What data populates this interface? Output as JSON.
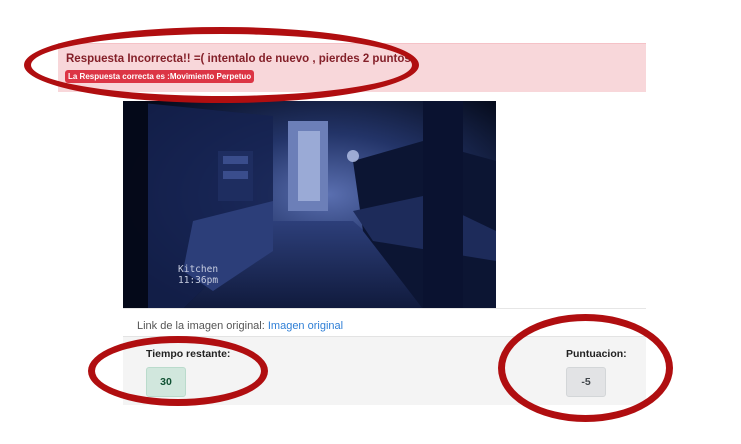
{
  "alert": {
    "message": "Respuesta Incorrecta!! =( intentalo de nuevo , pierdes 2 puntos",
    "badge": "La Respuesta correcta es :Movimiento Perpetuo",
    "colors": {
      "background": "#f8d7da",
      "text": "#842029",
      "badge": "#dc3545"
    }
  },
  "image": {
    "overlay_text": "Kitchen\n11:36pm",
    "description_icon": "image-photo-icon"
  },
  "source": {
    "prefix": "Link de la imagen original: ",
    "link_text": "Imagen original"
  },
  "stats": {
    "time_label": "Tiempo restante:",
    "time_value": "30",
    "score_label": "Puntuacion:",
    "score_value": "-5"
  },
  "annotations": {
    "circle_color": "#b00e10"
  }
}
